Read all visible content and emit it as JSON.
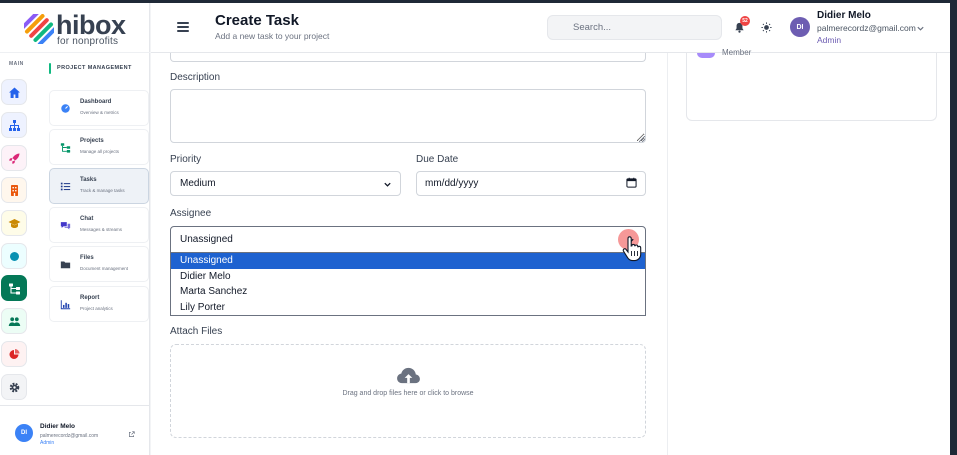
{
  "app": {
    "logo_word": "hibox",
    "logo_sub": "for nonprofits"
  },
  "header": {
    "title": "Create Task",
    "subtitle": "Add a new task to your project",
    "search_placeholder": "Search...",
    "notification_count": "52",
    "user": {
      "initials": "DI",
      "name": "Didier Melo",
      "email": "palmerecordz@gmail.com",
      "role": "Admin"
    }
  },
  "sidebar": {
    "rail_label": "MAIN",
    "section_title": "PROJECT MANAGEMENT",
    "rail_icons": [
      {
        "name": "home-icon",
        "color": "#2563eb",
        "bg": "#eef2ff"
      },
      {
        "name": "hierarchy-icon",
        "color": "#2563eb",
        "bg": "#eef2ff"
      },
      {
        "name": "rocket-icon",
        "color": "#db2777",
        "bg": "#fdf2f8"
      },
      {
        "name": "building-icon",
        "color": "#ea580c",
        "bg": "#fff7ed"
      },
      {
        "name": "graduation-icon",
        "color": "#ca8a04",
        "bg": "#fefce8"
      },
      {
        "name": "circle-icon",
        "color": "#0891b2",
        "bg": "#ecfeff"
      },
      {
        "name": "project-tree-icon",
        "color": "#ffffff",
        "bg": "#047857"
      },
      {
        "name": "users-icon",
        "color": "#047857",
        "bg": "#ecfdf5"
      },
      {
        "name": "pie-chart-icon",
        "color": "#dc2626",
        "bg": "#fef2f2"
      },
      {
        "name": "gear-icon",
        "color": "#374151",
        "bg": "#f3f4f6"
      }
    ],
    "menu": [
      {
        "title": "Dashboard",
        "subtitle": "Overview & metrics",
        "icon": "dashboard-icon",
        "color": "#3b82f6"
      },
      {
        "title": "Projects",
        "subtitle": "Manage all projects",
        "icon": "project-tree-icon",
        "color": "#059669"
      },
      {
        "title": "Tasks",
        "subtitle": "Track & manage tasks",
        "icon": "task-list-icon",
        "color": "#1e3a8a"
      },
      {
        "title": "Chat",
        "subtitle": "Messages & streams",
        "icon": "chat-icon",
        "color": "#4338ca"
      },
      {
        "title": "Files",
        "subtitle": "Document management",
        "icon": "folder-icon",
        "color": "#374151"
      },
      {
        "title": "Report",
        "subtitle": "Project analytics",
        "icon": "report-icon",
        "color": "#1e40af"
      }
    ],
    "user": {
      "initials": "DI",
      "name": "Didier Melo",
      "email": "palmerecordz@gmail.com",
      "role": "Admin"
    }
  },
  "form": {
    "description_label": "Description",
    "description_value": "",
    "priority_label": "Priority",
    "priority_value": "Medium",
    "due_date_label": "Due Date",
    "due_date_placeholder": "mm/dd/yyyy",
    "assignee_label": "Assignee",
    "assignee_value": "Unassigned",
    "assignee_options": [
      "Unassigned",
      "Didier Melo",
      "Marta Sanchez",
      "Lily Porter"
    ],
    "attach_label": "Attach Files",
    "dropzone_text": "Drag and drop files here or click to browse"
  },
  "right_panel": {
    "member_role": "Member"
  },
  "colors": {
    "accent": "#047857",
    "selection": "#1e62d0",
    "avatar": "#6d5db2"
  }
}
